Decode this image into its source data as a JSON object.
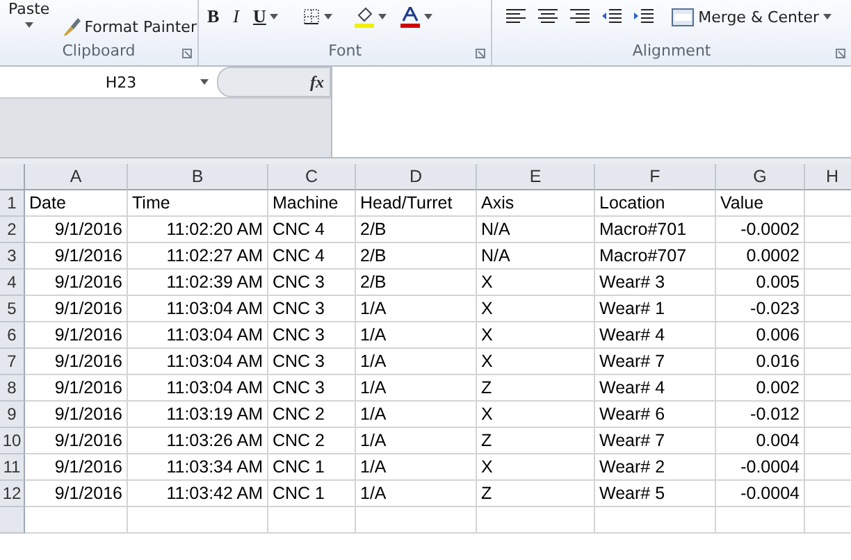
{
  "ribbon": {
    "clipboard": {
      "paste": "Paste",
      "format_painter": "Format Painter",
      "label": "Clipboard"
    },
    "font": {
      "bold": "B",
      "italic": "I",
      "underline": "U",
      "label": "Font"
    },
    "alignment": {
      "merge": "Merge & Center",
      "label": "Alignment"
    }
  },
  "formula_bar": {
    "name_box": "H23",
    "fx": "fx"
  },
  "sheet": {
    "columns": [
      {
        "letter": "A",
        "kind": "number"
      },
      {
        "letter": "B",
        "kind": "number"
      },
      {
        "letter": "C",
        "kind": "text"
      },
      {
        "letter": "D",
        "kind": "text"
      },
      {
        "letter": "E",
        "kind": "text"
      },
      {
        "letter": "F",
        "kind": "text"
      },
      {
        "letter": "G",
        "kind": "number"
      },
      {
        "letter": "H",
        "kind": "text"
      }
    ],
    "rows": [
      {
        "number": "1",
        "cells": [
          "Date",
          "Time",
          "Machine",
          "Head/Turret",
          "Axis",
          "Location",
          "Value"
        ]
      },
      {
        "number": "2",
        "cells": [
          "9/1/2016",
          "11:02:20 AM",
          "CNC 4",
          "2/B",
          "N/A",
          "Macro#701",
          "-0.0002"
        ]
      },
      {
        "number": "3",
        "cells": [
          "9/1/2016",
          "11:02:27 AM",
          "CNC 4",
          "2/B",
          "N/A",
          "Macro#707",
          "0.0002"
        ]
      },
      {
        "number": "4",
        "cells": [
          "9/1/2016",
          "11:02:39 AM",
          "CNC 3",
          "2/B",
          "X",
          "Wear# 3",
          "0.005"
        ]
      },
      {
        "number": "5",
        "cells": [
          "9/1/2016",
          "11:03:04 AM",
          "CNC 3",
          "1/A",
          "X",
          "Wear# 1",
          "-0.023"
        ]
      },
      {
        "number": "6",
        "cells": [
          "9/1/2016",
          "11:03:04 AM",
          "CNC 3",
          "1/A",
          "X",
          "Wear# 4",
          "0.006"
        ]
      },
      {
        "number": "7",
        "cells": [
          "9/1/2016",
          "11:03:04 AM",
          "CNC 3",
          "1/A",
          "X",
          "Wear# 7",
          "0.016"
        ]
      },
      {
        "number": "8",
        "cells": [
          "9/1/2016",
          "11:03:04 AM",
          "CNC 3",
          "1/A",
          "Z",
          "Wear# 4",
          "0.002"
        ]
      },
      {
        "number": "9",
        "cells": [
          "9/1/2016",
          "11:03:19 AM",
          "CNC 2",
          "1/A",
          "X",
          "Wear# 6",
          "-0.012"
        ]
      },
      {
        "number": "10",
        "cells": [
          "9/1/2016",
          "11:03:26 AM",
          "CNC 2",
          "1/A",
          "Z",
          "Wear# 7",
          "0.004"
        ]
      },
      {
        "number": "11",
        "cells": [
          "9/1/2016",
          "11:03:34 AM",
          "CNC 1",
          "1/A",
          "X",
          "Wear# 2",
          "-0.0004"
        ]
      },
      {
        "number": "12",
        "cells": [
          "9/1/2016",
          "11:03:42 AM",
          "CNC 1",
          "1/A",
          "Z",
          "Wear# 5",
          "-0.0004"
        ]
      }
    ]
  }
}
